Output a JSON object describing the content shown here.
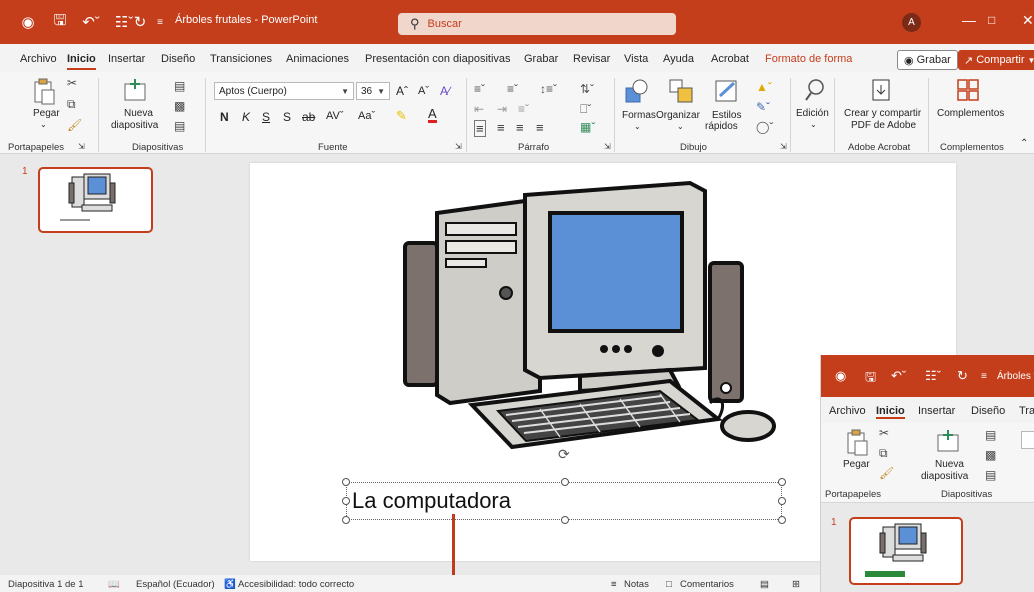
{
  "titlebar": {
    "doc_title": "Árboles frutales - PowerPoint",
    "search_placeholder": "Buscar",
    "avatar_initial": "A"
  },
  "menu": {
    "tabs": [
      "Archivo",
      "Inicio",
      "Insertar",
      "Diseño",
      "Transiciones",
      "Animaciones",
      "Presentación con diapositivas",
      "Grabar",
      "Revisar",
      "Vista",
      "Ayuda",
      "Acrobat",
      "Formato de forma"
    ],
    "active": "Inicio",
    "contextual_tab": "Formato de forma",
    "grabar_label": "Grabar",
    "compartir_label": "Compartir"
  },
  "ribbon": {
    "pegar": "Pegar",
    "nueva_diapositiva_1": "Nueva",
    "nueva_diapositiva_2": "diapositiva",
    "font_name": "Aptos (Cuerpo)",
    "font_size": "36",
    "bold": "N",
    "italic": "K",
    "underline": "S",
    "strike": "S",
    "formas": "Formas",
    "organizar": "Organizar",
    "estilos_1": "Estilos",
    "estilos_2": "rápidos",
    "edicion": "Edición",
    "crear_pdf_1": "Crear y compartir",
    "crear_pdf_2": "PDF de Adobe",
    "complementos": "Complementos",
    "groups": {
      "portapapeles": "Portapapeles",
      "diapositivas": "Diapositivas",
      "fuente": "Fuente",
      "parrafo": "Párrafo",
      "dibujo": "Dibujo",
      "adobe": "Adobe Acrobat",
      "complementos": "Complementos"
    }
  },
  "slide_panel": {
    "slide_number": "1"
  },
  "slide": {
    "caption": "La computadora"
  },
  "statusbar": {
    "slide_info": "Diapositiva 1 de 1",
    "language": "Español (Ecuador)",
    "accessibility": "Accesibilidad: todo correcto",
    "notas": "Notas",
    "comentarios": "Comentarios"
  },
  "inset": {
    "title_partial": "Árboles frut",
    "tabs": [
      "Archivo",
      "Inicio",
      "Insertar",
      "Diseño",
      "Tra"
    ],
    "pegar": "Pegar",
    "nueva_1": "Nueva",
    "nueva_2": "diapositiva",
    "grp_portapapeles": "Portapapeles",
    "grp_diapositivas": "Diapositivas",
    "slide_number": "1"
  },
  "colors": {
    "accent": "#c43e1c",
    "monitor_screen": "#5b8fd6",
    "inset_label_bar": "#2a8a3a"
  }
}
